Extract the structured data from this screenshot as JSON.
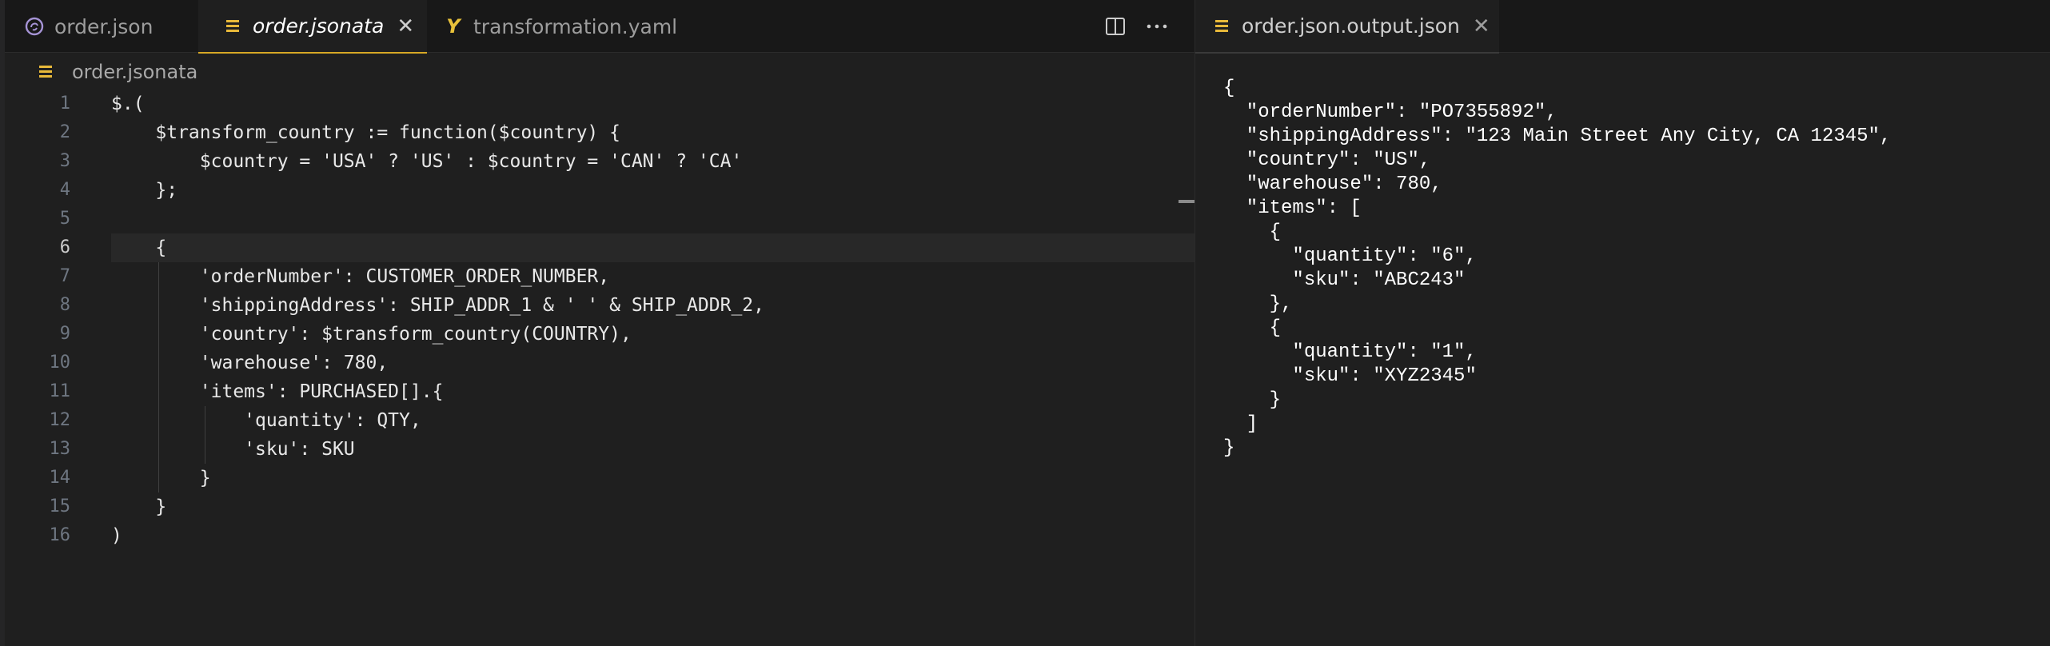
{
  "left_group": {
    "tabs": [
      {
        "label": "order.json",
        "icon": "jsonata-logo-icon",
        "active": false
      },
      {
        "label": "order.jsonata",
        "icon": "lines-icon",
        "active": true
      },
      {
        "label": "transformation.yaml",
        "icon": "yaml-icon",
        "active": false
      }
    ],
    "toolbar": {
      "split": "split-editor-icon",
      "more": "more-actions-icon"
    },
    "breadcrumb": "order.jsonata",
    "code_lines": [
      "$.(",
      "    $transform_country := function($country) {",
      "        $country = 'USA' ? 'US' : $country = 'CAN' ? 'CA'",
      "    };",
      "",
      "    {",
      "        'orderNumber': CUSTOMER_ORDER_NUMBER,",
      "        'shippingAddress': SHIP_ADDR_1 & ' ' & SHIP_ADDR_2,",
      "        'country': $transform_country(COUNTRY),",
      "        'warehouse': 780,",
      "        'items': PURCHASED[].{",
      "            'quantity': QTY,",
      "            'sku': SKU",
      "        }",
      "    }",
      ")"
    ],
    "line_numbers": [
      "1",
      "2",
      "3",
      "4",
      "5",
      "6",
      "7",
      "8",
      "9",
      "10",
      "11",
      "12",
      "13",
      "14",
      "15",
      "16"
    ],
    "current_line": 6
  },
  "right_group": {
    "tab": {
      "label": "order.json.output.json",
      "icon": "lines-icon"
    },
    "output_lines": [
      "{",
      "  \"orderNumber\": \"PO7355892\",",
      "  \"shippingAddress\": \"123 Main Street Any City, CA 12345\",",
      "  \"country\": \"US\",",
      "  \"warehouse\": 780,",
      "  \"items\": [",
      "    {",
      "      \"quantity\": \"6\",",
      "      \"sku\": \"ABC243\"",
      "    },",
      "    {",
      "      \"quantity\": \"1\",",
      "      \"sku\": \"XYZ2345\"",
      "    }",
      "  ]",
      "}"
    ]
  },
  "colors": {
    "active_tab_accent": "#d7a825",
    "file_icon": "#e8b93a",
    "jsonata_logo": "#a694d6"
  }
}
